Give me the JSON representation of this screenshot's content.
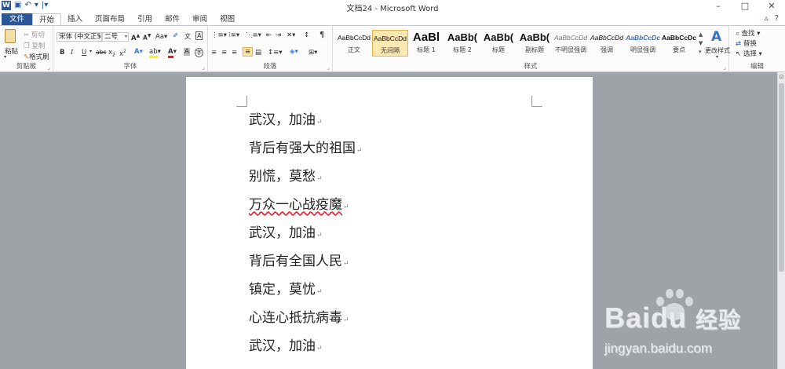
{
  "window": {
    "title": "文档24 - Microsoft Word",
    "app_icon": "word-icon",
    "quick_access": [
      "save-icon",
      "undo-icon",
      "redo-icon",
      "customize-icon"
    ],
    "controls": [
      "minimize-icon",
      "maximize-icon",
      "close-icon"
    ]
  },
  "tabs": [
    {
      "label": "文件"
    },
    {
      "label": "开始"
    },
    {
      "label": "插入"
    },
    {
      "label": "页面布局"
    },
    {
      "label": "引用"
    },
    {
      "label": "邮件"
    },
    {
      "label": "审阅"
    },
    {
      "label": "视图"
    }
  ],
  "ribbon": {
    "clipboard": {
      "label": "剪贴板",
      "paste": "粘贴",
      "cut": "剪切",
      "copy": "复制",
      "format_painter": "格式刷"
    },
    "font": {
      "label": "字体",
      "font_name": "宋体 (中文正5",
      "font_size": "二号",
      "grow": "A",
      "shrink": "A",
      "change_case": "Aa",
      "bold": "B",
      "italic": "I",
      "underline": "U",
      "strike": "abc",
      "subscript": "x",
      "superscript": "x",
      "highlight": "A",
      "font_color": "A"
    },
    "paragraph": {
      "label": "段落"
    },
    "styles": {
      "label": "样式",
      "items": [
        {
          "sample": "AaBbCcDd",
          "name": "正文"
        },
        {
          "sample": "AaBbCcDd",
          "name": "无间隔"
        },
        {
          "sample": "AaBl",
          "name": "标题 1"
        },
        {
          "sample": "AaBb(",
          "name": "标题 2"
        },
        {
          "sample": "AaBb(",
          "name": "标题"
        },
        {
          "sample": "AaBb(",
          "name": "副标题"
        },
        {
          "sample": "AaBbCcDd",
          "name": "不明显强调"
        },
        {
          "sample": "AaBbCcDd",
          "name": "强调"
        },
        {
          "sample": "AaBbCcDc",
          "name": "明显强调"
        },
        {
          "sample": "AaBbCcDc",
          "name": "要点"
        }
      ],
      "change_styles": "更改样式"
    },
    "editing": {
      "label": "编辑",
      "find": "查找",
      "replace": "替换",
      "select": "选择"
    }
  },
  "document": {
    "lines": [
      {
        "text": "武汉，加油"
      },
      {
        "text": "背后有强大的祖国"
      },
      {
        "text": "别慌，莫愁"
      },
      {
        "text": "万众一心战疫魔"
      },
      {
        "text": "武汉，加油"
      },
      {
        "text": "背后有全国人民"
      },
      {
        "text": "镇定，莫忧"
      },
      {
        "text": "心连心抵抗病毒"
      },
      {
        "text": "武汉，加油"
      }
    ],
    "paragraph_mark": "↵"
  },
  "watermark": {
    "brand": "Bai",
    "brand2": "du",
    "brand_cn": "经验",
    "url": "jingyan.baidu.com"
  }
}
